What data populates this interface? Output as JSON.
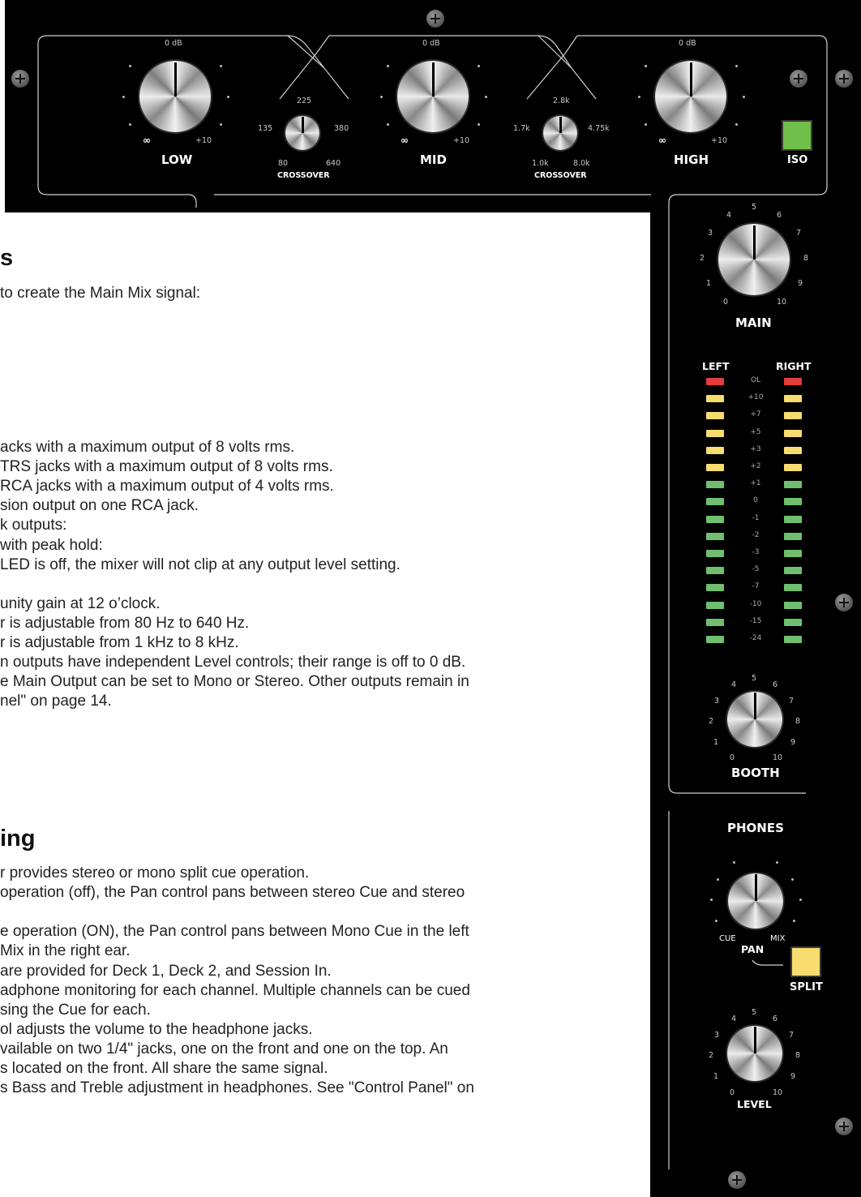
{
  "eq": {
    "low_label": "LOW",
    "mid_label": "MID",
    "high_label": "HIGH",
    "iso_label": "ISO",
    "zero_db": "0 dB",
    "inf": "∞",
    "plus10": "+10",
    "crossover_label": "CROSSOVER",
    "x1": {
      "top": "225",
      "left": "135",
      "right": "380",
      "bl": "80",
      "br": "640"
    },
    "x2": {
      "top": "2.8k",
      "left": "1.7k",
      "right": "4.75k",
      "bl": "1.0k",
      "br": "8.0k"
    }
  },
  "right_panel": {
    "main_label": "MAIN",
    "main_scale": [
      "0",
      "1",
      "2",
      "3",
      "4",
      "5",
      "6",
      "7",
      "8",
      "9",
      "10"
    ],
    "left_label": "LEFT",
    "right_label": "RIGHT",
    "meter_marks": [
      "OL",
      "+10",
      "+7",
      "+5",
      "+3",
      "+2",
      "+1",
      "0",
      "-1",
      "-2",
      "-3",
      "-5",
      "-7",
      "-10",
      "-15",
      "-24"
    ],
    "booth_label": "BOOTH",
    "phones_label": "PHONES",
    "cue_label": "CUE",
    "pan_label": "PAN",
    "mix_label": "MIX",
    "split_label": "SPLIT",
    "level_label": "LEVEL",
    "colors": {
      "led_red": "#e63b3b",
      "led_yellow": "#f7dc6f",
      "led_green": "#6fbf6f",
      "iso_green": "#6fbf4a",
      "split_yellow": "#f7dc6f"
    }
  },
  "document": {
    "heading1": "s",
    "intro": "to create the Main Mix signal:",
    "lines1": [
      "acks with a maximum output of 8 volts rms.",
      " TRS jacks with a maximum output of 8 volts rms.",
      " RCA jacks with a maximum output of 4 volts rms.",
      "sion output on one RCA jack.",
      "k outputs:",
      " with peak hold:",
      "LED is off, the mixer will not clip at any output level setting.",
      "",
      "unity gain at 12 o’clock.",
      "r is adjustable from 80 Hz to 640 Hz.",
      "r is adjustable from 1 kHz to 8 kHz.",
      "n outputs have independent Level controls; their range is off to 0 dB.",
      "e Main Output can be set to Mono or Stereo. Other outputs remain in",
      "nel\" on page 14."
    ],
    "heading2": "ing",
    "lines2": [
      "r provides stereo or mono split cue operation.",
      "operation (off), the Pan control pans between stereo Cue and stereo",
      "",
      "e operation (ON), the Pan control pans between Mono Cue in the left",
      "Mix in the right ear.",
      "are provided for Deck 1, Deck 2, and Session In.",
      "adphone monitoring for each channel. Multiple channels can be cued",
      "sing the Cue for each.",
      "ol adjusts the volume to the headphone jacks.",
      "vailable on two 1/4\" jacks, one on the front and one on the top. An",
      "s located on the front. All share the same signal.",
      "s Bass and Treble adjustment in headphones. See \"Control Panel\" on"
    ]
  }
}
